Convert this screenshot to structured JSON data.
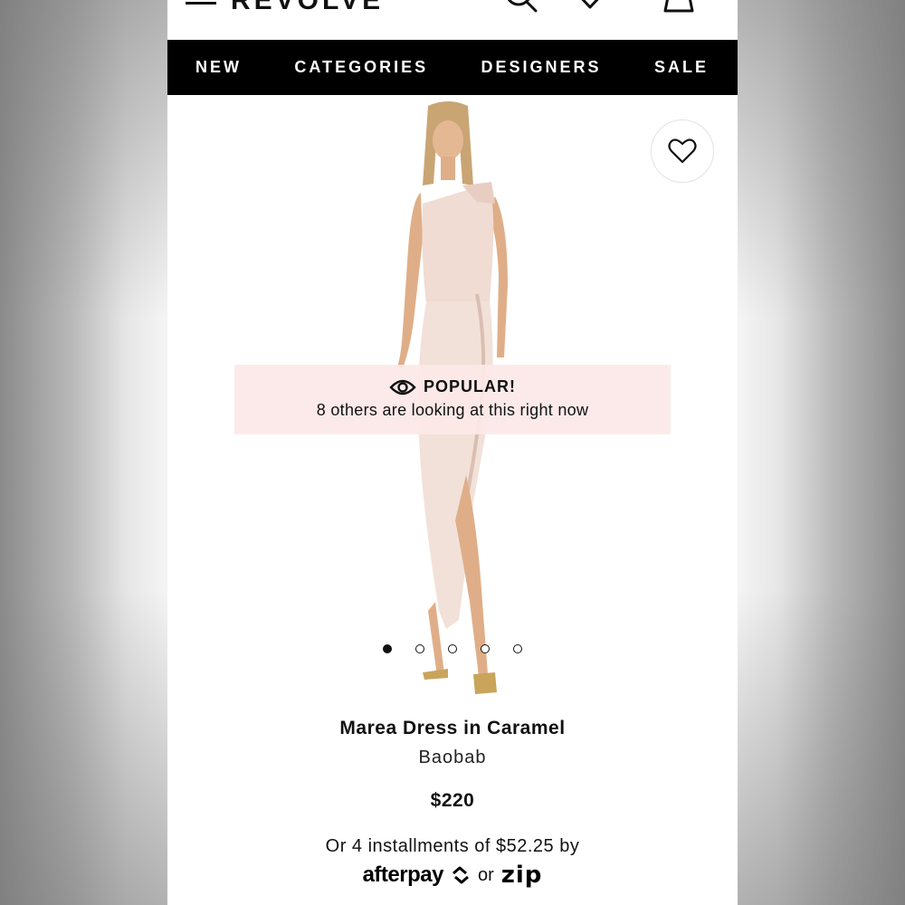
{
  "header": {
    "logo_text": "REVOLVE",
    "icons": [
      "menu-icon",
      "search-icon",
      "heart-icon",
      "bag-icon"
    ]
  },
  "nav": {
    "items": [
      "NEW",
      "CATEGORIES",
      "DESIGNERS",
      "SALE"
    ]
  },
  "popular_banner": {
    "title": "POPULAR!",
    "message": "8 others are looking at this right now",
    "icon": "eye-icon"
  },
  "carousel": {
    "total_slides": 5,
    "active_index": 0
  },
  "product": {
    "name": "Marea Dress in Caramel",
    "brand": "Baobab",
    "price": "$220",
    "installments_text": "Or 4 installments of $52.25 by",
    "pay_option_1": "afterpay",
    "or_text": "or",
    "pay_option_2": "zip"
  },
  "colors": {
    "nav_bg": "#000000",
    "banner_bg": "#fce8e8",
    "dress": "#f0dcd2"
  }
}
